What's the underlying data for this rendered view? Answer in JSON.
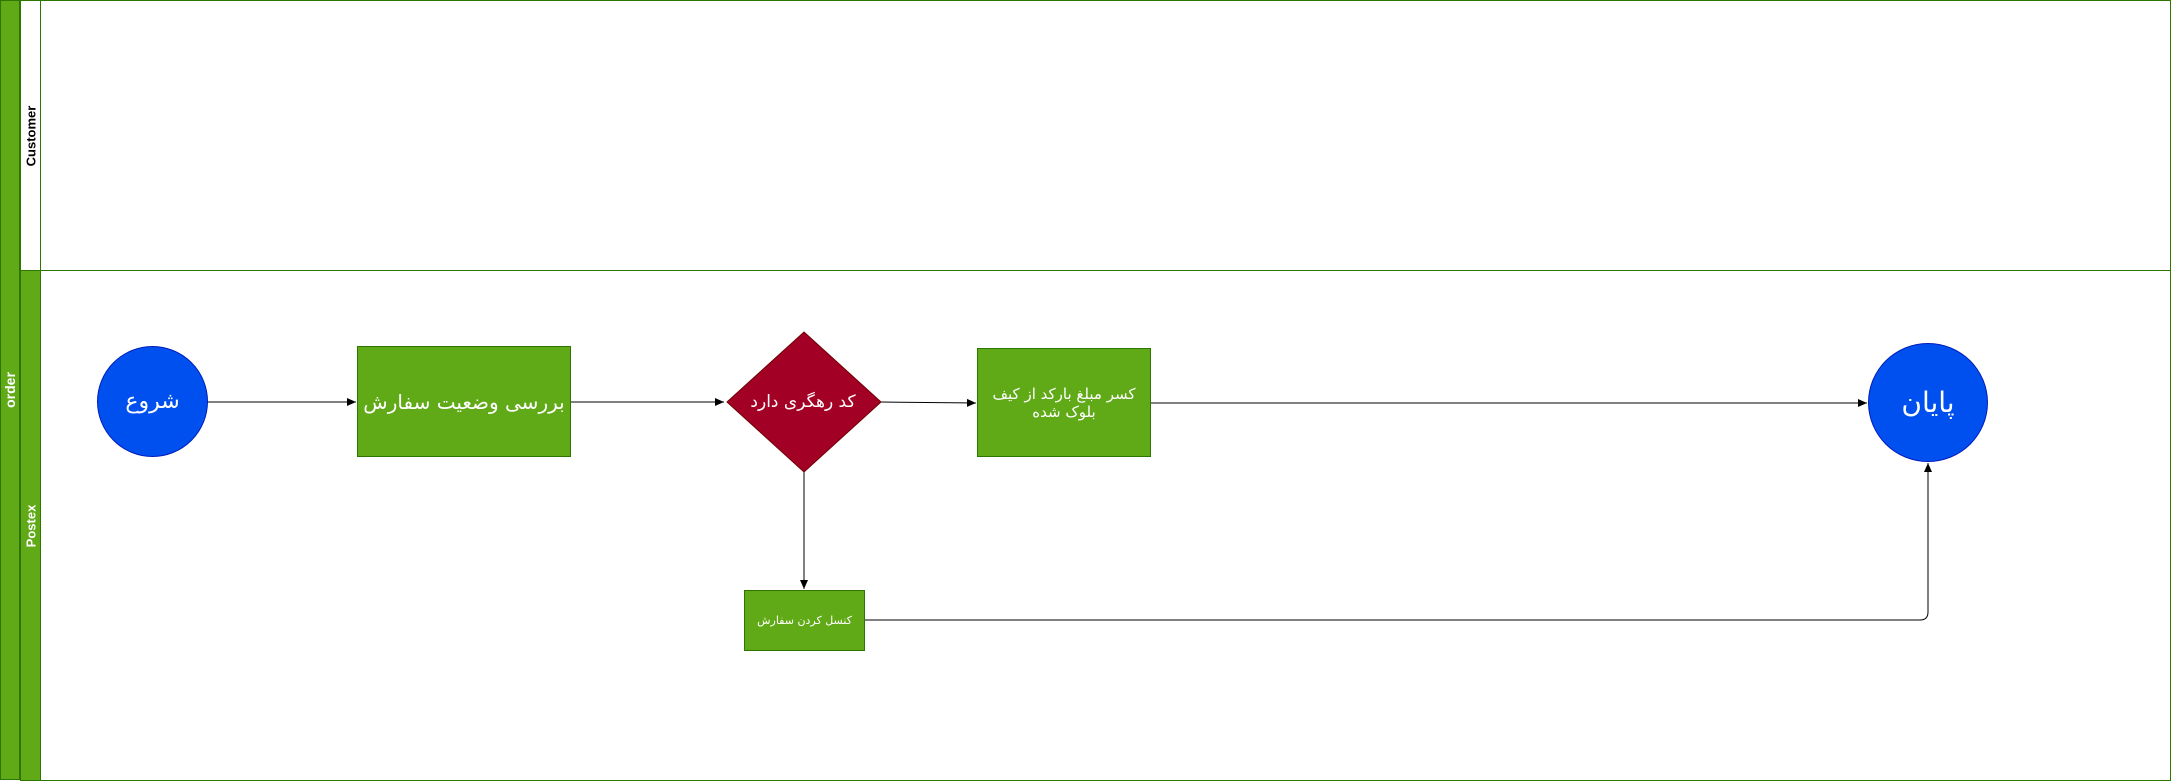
{
  "pool": {
    "label": "order"
  },
  "lanes": {
    "customer": {
      "label": "Customer"
    },
    "postex": {
      "label": "Postex"
    }
  },
  "nodes": {
    "start": "شروع",
    "check_order": "بررسی وضعیت سفارش",
    "decision": "کد رهگری دارد",
    "deduct": "کسر مبلغ بارکد از کیف بلوک شده",
    "cancel": "کنسل کردن سفارش",
    "end": "پایان"
  },
  "colors": {
    "task_fill": "#60a917",
    "task_stroke": "#2d7600",
    "event_fill": "#0050ef",
    "gateway_fill": "#a20025",
    "edge": "#000000"
  }
}
